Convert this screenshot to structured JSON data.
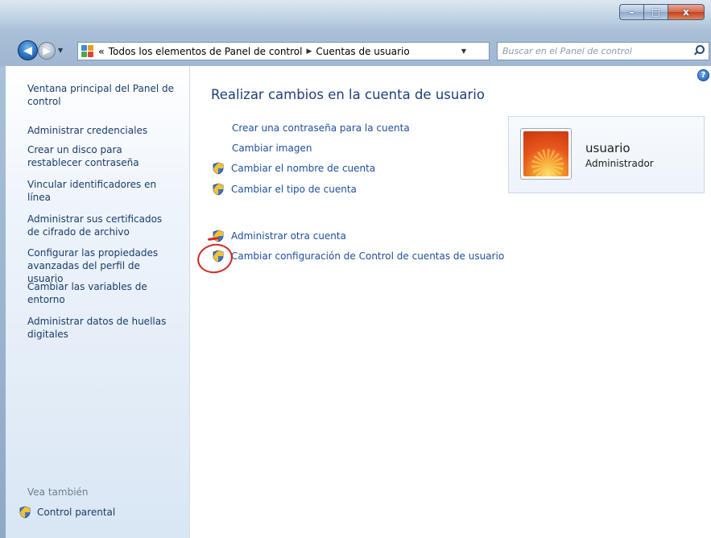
{
  "window": {
    "caption_buttons": {
      "minimize": "–",
      "maximize": "□",
      "close": "x"
    }
  },
  "nav": {
    "back_icon": "back-arrow-icon",
    "forward_icon": "forward-arrow-icon",
    "breadcrumb_prefix": "«",
    "breadcrumb": [
      "Todos los elementos de Panel de control",
      "Cuentas de usuario"
    ],
    "search_placeholder": "Buscar en el Panel de control"
  },
  "sidebar": {
    "items": [
      {
        "label": "Ventana principal del Panel de control"
      },
      {
        "label": "Administrar credenciales"
      },
      {
        "label": "Crear un disco para restablecer contraseña"
      },
      {
        "label": "Vincular identificadores en línea"
      },
      {
        "label": "Administrar sus certificados de cifrado de archivo"
      },
      {
        "label": "Configurar las propiedades avanzadas del perfil de usuario"
      },
      {
        "label": "Cambiar las variables de entorno"
      },
      {
        "label": "Administrar datos de huellas digitales"
      }
    ],
    "see_also": "Vea también",
    "parental": "Control parental"
  },
  "main": {
    "heading": "Realizar cambios en la cuenta de usuario",
    "help": "?",
    "tasks": [
      {
        "label": "Crear una contraseña para la cuenta",
        "shield": false
      },
      {
        "label": "Cambiar imagen",
        "shield": false
      },
      {
        "label": "Cambiar el nombre de cuenta",
        "shield": true
      },
      {
        "label": "Cambiar el tipo de cuenta",
        "shield": true
      }
    ],
    "other_tasks": [
      {
        "label": "Administrar otra cuenta",
        "shield": true
      },
      {
        "label": "Cambiar configuración de Control de cuentas de usuario",
        "shield": true
      }
    ],
    "user": {
      "name": "usuario",
      "role": "Administrador"
    }
  },
  "colors": {
    "link": "#1d4e9f",
    "sidebar_link": "#183c6b",
    "annotation": "#d22a25"
  }
}
